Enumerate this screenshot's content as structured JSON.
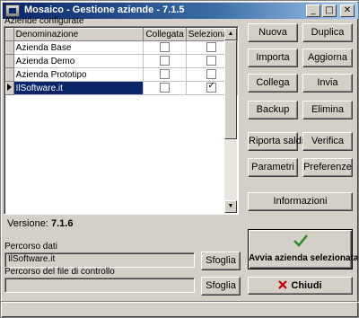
{
  "window": {
    "title": "Mosaico - Gestione aziende - 7.1.5",
    "minimize": "_",
    "maximize": "□",
    "close": "✕"
  },
  "companies": {
    "label": "Aziende configurate",
    "columns": [
      "Denominazione",
      "Collegata",
      "Selezionata"
    ],
    "rows": [
      {
        "name": "Azienda Base",
        "connected": false,
        "selected": false
      },
      {
        "name": "Azienda Demo",
        "connected": false,
        "selected": false
      },
      {
        "name": "Azienda Prototipo",
        "connected": false,
        "selected": false
      },
      {
        "name": "IlSoftware.it",
        "connected": false,
        "selected": true,
        "current": true
      }
    ]
  },
  "buttons": {
    "nuova": "Nuova",
    "duplica": "Duplica",
    "importa": "Importa",
    "aggiorna": "Aggiorna",
    "collega": "Collega",
    "invia": "Invia",
    "backup": "Backup",
    "elimina": "Elimina",
    "riporta_saldi": "Riporta saldi",
    "verifica": "Verifica",
    "parametri": "Parametri",
    "preferenze": "Preferenze",
    "informazioni": "Informazioni",
    "sfoglia_dati": "Sfoglia",
    "sfoglia_controllo": "Sfoglia",
    "avvia": "Avvia azienda selezionata",
    "chiudi": "Chiudi"
  },
  "version": {
    "label": "Versione:",
    "value": "7.1.6"
  },
  "paths": {
    "dati_label": "Percorso dati",
    "dati_value": "IlSoftware.it",
    "controllo_label": "Percorso del file di controllo",
    "controllo_value": ""
  },
  "colors": {
    "accent_check": "#2e8b2e",
    "close_x": "#c00000",
    "selection": "#0a246a"
  },
  "icons": {
    "avvia": "green-check-icon",
    "chiudi": "red-x-icon"
  }
}
